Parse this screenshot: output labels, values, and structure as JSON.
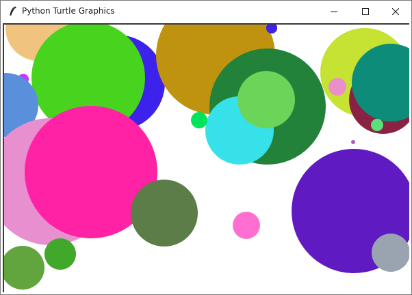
{
  "window": {
    "title": "Python Turtle Graphics"
  },
  "caption_buttons": {
    "minimize": "minimize",
    "maximize": "maximize",
    "close": "close"
  },
  "circles": [
    {
      "color": "#f0c47e"
    },
    {
      "color": "#3c22ea"
    },
    {
      "color": "#48d41e"
    },
    {
      "color": "#bf930f"
    },
    {
      "color": "#23823a"
    },
    {
      "color": "#c6e232"
    },
    {
      "color": "#8a2244"
    },
    {
      "color": "#0d8c7a"
    },
    {
      "color": "#e88fcf"
    },
    {
      "color": "#5a8fdc"
    },
    {
      "color": "#28234b"
    },
    {
      "color": "#ff22a5"
    },
    {
      "color": "#36e1e9"
    },
    {
      "color": "#6cd458"
    },
    {
      "color": "#00e35a"
    },
    {
      "color": "#5c7c48"
    },
    {
      "color": "#ff6fd2"
    },
    {
      "color": "#5f1ac1"
    },
    {
      "color": "#9aa4b0"
    },
    {
      "color": "#62a43e"
    },
    {
      "color": "#40a82a"
    },
    {
      "color": "#ea8fca"
    },
    {
      "color": "#5be07a"
    },
    {
      "color": "#b15ac5"
    },
    {
      "color": "#3c22ea"
    },
    {
      "color": "#c23cff"
    }
  ]
}
